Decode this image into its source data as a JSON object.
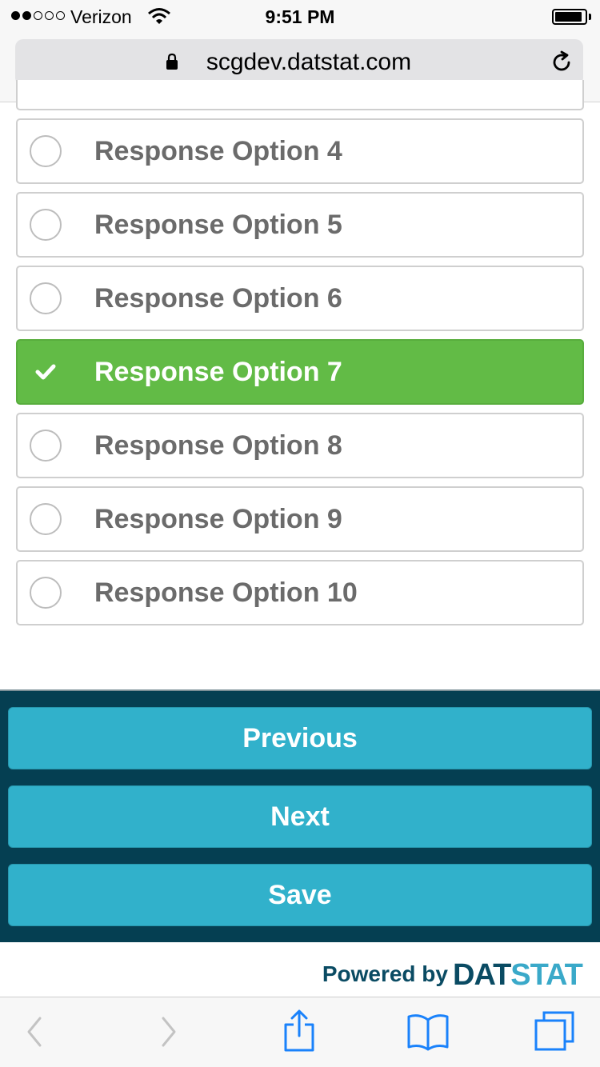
{
  "status_bar": {
    "carrier": "Verizon",
    "time": "9:51 PM",
    "signal_bars_filled": 2,
    "signal_bars_total": 5
  },
  "browser": {
    "url": "scgdev.datstat.com"
  },
  "options": [
    {
      "label": "Response Option 4",
      "selected": false
    },
    {
      "label": "Response Option 5",
      "selected": false
    },
    {
      "label": "Response Option 6",
      "selected": false
    },
    {
      "label": "Response Option 7",
      "selected": true
    },
    {
      "label": "Response Option 8",
      "selected": false
    },
    {
      "label": "Response Option 9",
      "selected": false
    },
    {
      "label": "Response Option 10",
      "selected": false
    }
  ],
  "navigation": {
    "previous_label": "Previous",
    "next_label": "Next",
    "save_label": "Save"
  },
  "footer": {
    "powered_by": "Powered by",
    "brand_dat": "DAT",
    "brand_stat": "STAT"
  },
  "colors": {
    "selected_green": "#62bb46",
    "nav_panel": "#053f52",
    "nav_button": "#31b1cb",
    "brand_dark": "#0a4b63",
    "brand_light": "#3aa9c9"
  },
  "icons": {
    "back": "chevron-left-icon",
    "forward": "chevron-right-icon",
    "share": "share-icon",
    "bookmarks": "book-icon",
    "tabs": "tabs-icon"
  }
}
